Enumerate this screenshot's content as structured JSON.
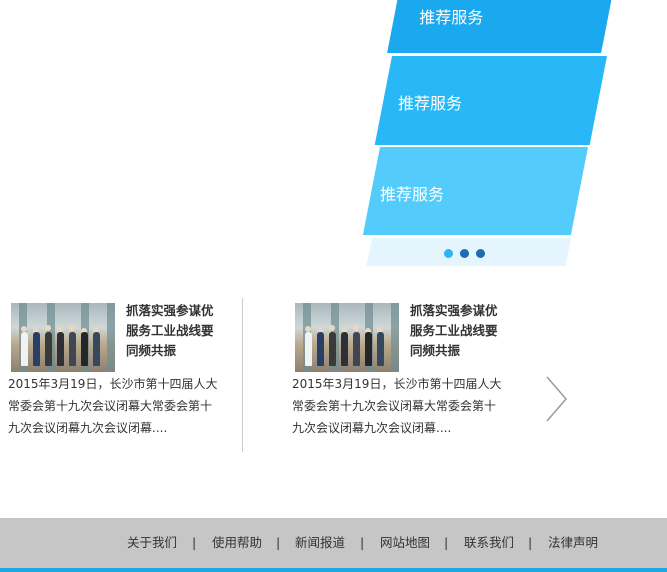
{
  "banner": {
    "slides": [
      {
        "label": "推荐服务"
      },
      {
        "label": "推荐服务"
      },
      {
        "label": "推荐服务"
      }
    ],
    "pagination": {
      "count": 3,
      "active_index": 0
    },
    "colors": {
      "slide1": "#1aa8ee",
      "slide2": "#28b8f7",
      "slide3": "#53ccfb",
      "dot_active": "#2fb6f2",
      "dot_idle": "#1d6bb3"
    }
  },
  "news": [
    {
      "title": "抓落实强参谋优服务工业战线要同频共振",
      "description": "2015年3月19日，长沙市第十四届人大常委会第十九次会议闭幕大常委会第十九次会议闭幕九次会议闭幕...."
    },
    {
      "title": "抓落实强参谋优服务工业战线要同频共振",
      "description": "2015年3月19日，长沙市第十四届人大常委会第十九次会议闭幕大常委会第十九次会议闭幕九次会议闭幕...."
    }
  ],
  "carousel": {
    "next_icon": "chevron-right-icon"
  },
  "footer": {
    "links": [
      "关于我们",
      "使用帮助",
      "新闻报道",
      "网站地图",
      "联系我们",
      "法律声明"
    ],
    "separator": "|",
    "colors": {
      "background": "#c6c6c6",
      "accent_bar": "#1fa6e0"
    }
  }
}
